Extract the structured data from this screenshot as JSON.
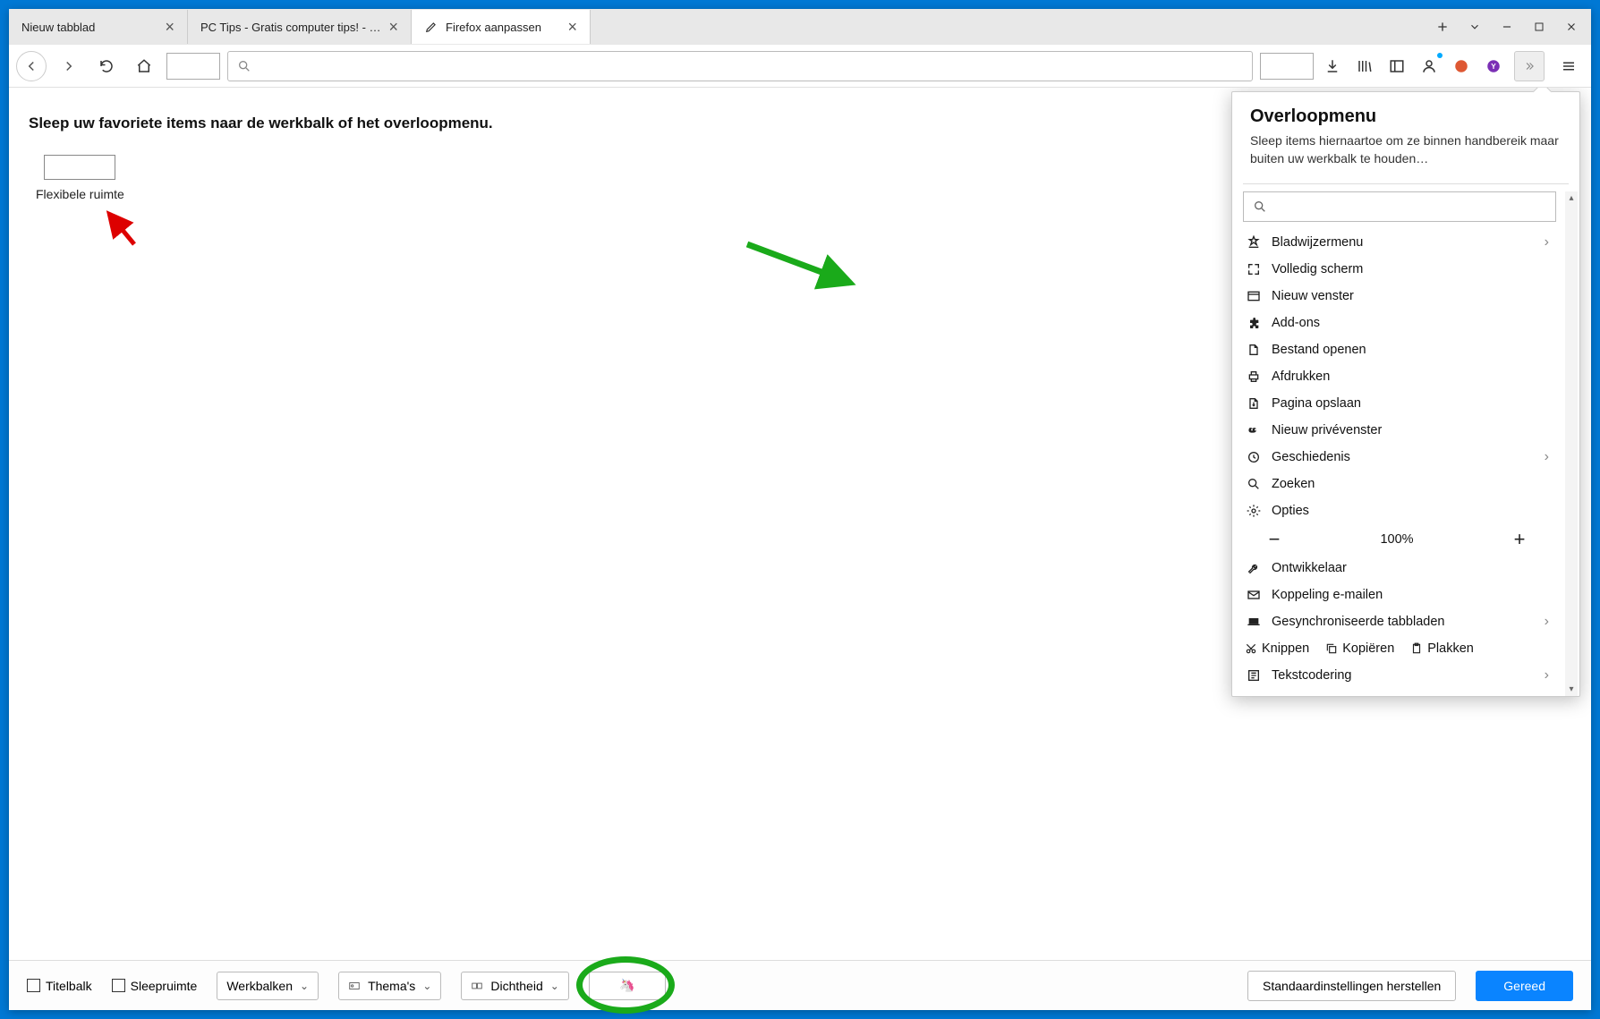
{
  "tabs": [
    {
      "label": "Nieuw tabblad"
    },
    {
      "label": "PC Tips - Gratis computer tips! - PC"
    },
    {
      "label": "Firefox aanpassen"
    }
  ],
  "instruction": "Sleep uw favoriete items naar de werkbalk of het overloopmenu.",
  "flex_space_label": "Flexibele ruimte",
  "panel": {
    "title": "Overloopmenu",
    "subtitle": "Sleep items hiernaartoe om ze binnen handbereik maar buiten uw werkbalk te houden…",
    "items": [
      {
        "label": "Bladwijzermenu",
        "chev": true
      },
      {
        "label": "Volledig scherm"
      },
      {
        "label": "Nieuw venster"
      },
      {
        "label": "Add-ons"
      },
      {
        "label": "Bestand openen"
      },
      {
        "label": "Afdrukken"
      },
      {
        "label": "Pagina opslaan"
      },
      {
        "label": "Nieuw privévenster"
      },
      {
        "label": "Geschiedenis",
        "chev": true
      },
      {
        "label": "Zoeken"
      },
      {
        "label": "Opties"
      }
    ],
    "zoom": "100%",
    "items2": [
      {
        "label": "Ontwikkelaar"
      },
      {
        "label": "Koppeling e-mailen"
      },
      {
        "label": "Gesynchroniseerde tabbladen",
        "chev": true
      }
    ],
    "clip": {
      "cut": "Knippen",
      "copy": "Kopiëren",
      "paste": "Plakken"
    },
    "encoding": {
      "label": "Tekstcodering",
      "chev": true
    }
  },
  "footer": {
    "titlebar": "Titelbalk",
    "dragspace": "Sleepruimte",
    "toolbars": "Werkbalken",
    "themes": "Thema's",
    "density": "Dichtheid",
    "restore": "Standaardinstellingen herstellen",
    "done": "Gereed"
  }
}
